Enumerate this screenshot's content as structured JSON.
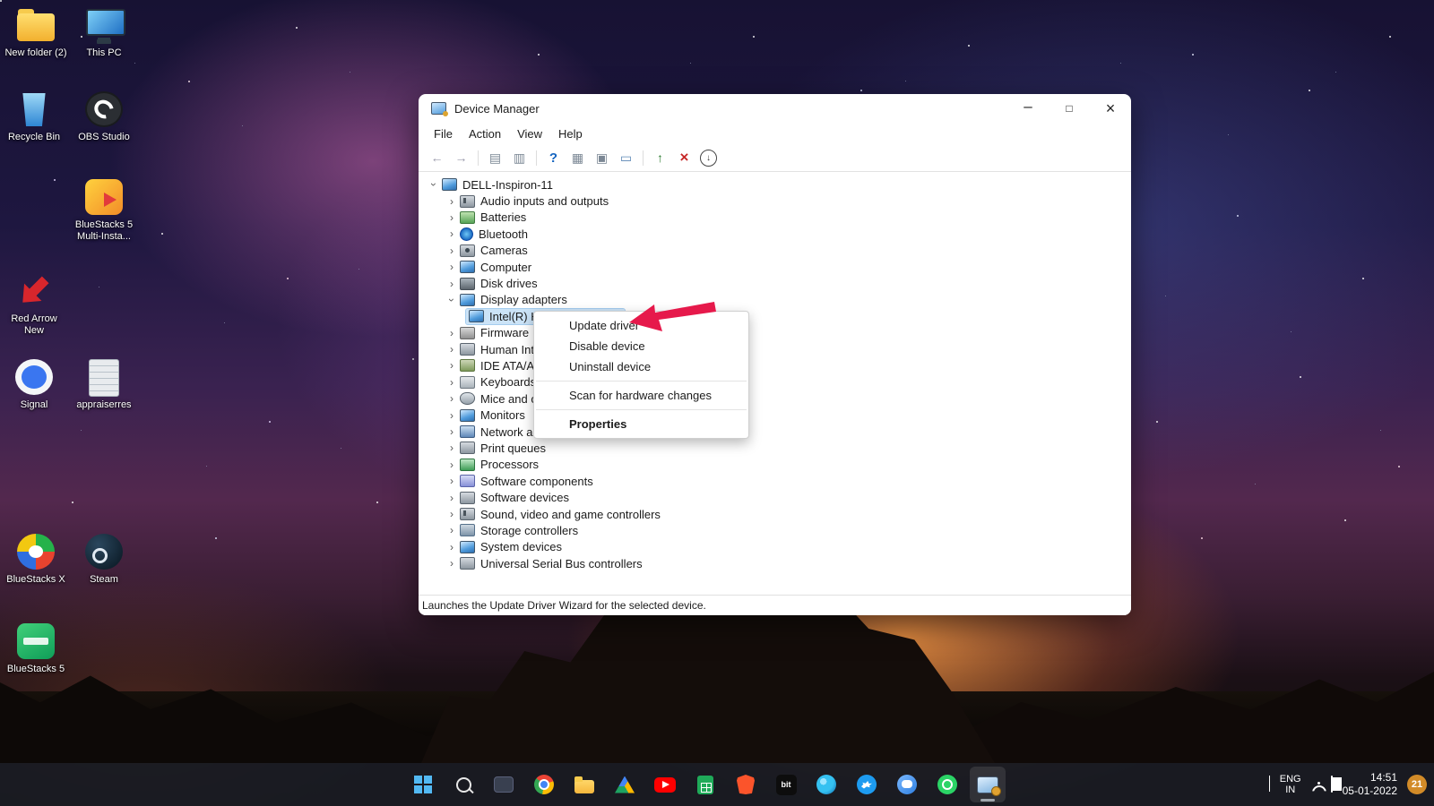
{
  "desktop": {
    "icons": [
      {
        "label": "New folder (2)",
        "icon": "folder"
      },
      {
        "label": "This PC",
        "icon": "this-pc"
      },
      {
        "label": "Recycle Bin",
        "icon": "recycle-bin"
      },
      {
        "label": "OBS Studio",
        "icon": "obs-studio"
      },
      {
        "label": "BlueStacks 5 Multi-Insta...",
        "icon": "bluestacks-multi"
      },
      {
        "label": "Red Arrow New",
        "icon": "red-arrow"
      },
      {
        "label": "Signal",
        "icon": "signal"
      },
      {
        "label": "appraiserres",
        "icon": "notepad"
      },
      {
        "label": "BlueStacks X",
        "icon": "bluestacks-x"
      },
      {
        "label": "Steam",
        "icon": "steam"
      },
      {
        "label": "BlueStacks 5",
        "icon": "bluestacks-5"
      }
    ]
  },
  "window": {
    "title": "Device Manager",
    "menu": [
      "File",
      "Action",
      "View",
      "Help"
    ],
    "toolbar_icons": [
      "back",
      "forward",
      "console-tree",
      "export-list",
      "help",
      "devices-by-type",
      "scan-hardware-changes",
      "monitor",
      "update-driver",
      "uninstall-device",
      "disable-device"
    ],
    "tree": {
      "root": "DELL-Inspiron-11",
      "items": [
        {
          "label": "Audio inputs and outputs",
          "icon": "speaker"
        },
        {
          "label": "Batteries",
          "icon": "battery"
        },
        {
          "label": "Bluetooth",
          "icon": "bluetooth"
        },
        {
          "label": "Cameras",
          "icon": "camera"
        },
        {
          "label": "Computer",
          "icon": "computer"
        },
        {
          "label": "Disk drives",
          "icon": "disk"
        },
        {
          "label": "Display adapters",
          "icon": "display",
          "expanded": true
        },
        {
          "label": "Intel(R) HD Graphics 620",
          "icon": "gpu",
          "child": true,
          "selected": true
        },
        {
          "label": "Firmware",
          "icon": "firmware"
        },
        {
          "label": "Human Interface Devices",
          "icon": "hid"
        },
        {
          "label": "IDE ATA/ATAPI controllers",
          "icon": "ide"
        },
        {
          "label": "Keyboards",
          "icon": "keyboard"
        },
        {
          "label": "Mice and other pointing devices",
          "icon": "mouse"
        },
        {
          "label": "Monitors",
          "icon": "monitor"
        },
        {
          "label": "Network adapters",
          "icon": "network"
        },
        {
          "label": "Print queues",
          "icon": "printer"
        },
        {
          "label": "Processors",
          "icon": "processor"
        },
        {
          "label": "Software components",
          "icon": "software-component"
        },
        {
          "label": "Software devices",
          "icon": "software-device"
        },
        {
          "label": "Sound, video and game controllers",
          "icon": "sound"
        },
        {
          "label": "Storage controllers",
          "icon": "storage"
        },
        {
          "label": "System devices",
          "icon": "system"
        },
        {
          "label": "Universal Serial Bus controllers",
          "icon": "usb"
        }
      ]
    },
    "status": "Launches the Update Driver Wizard for the selected device."
  },
  "context_menu": {
    "items": [
      "Update driver",
      "Disable device",
      "Uninstall device",
      "Scan for hardware changes",
      "Properties"
    ]
  },
  "taskbar": {
    "icons": [
      "start",
      "search",
      "task-view",
      "chrome",
      "file-explorer",
      "google-drive",
      "youtube",
      "sheets",
      "brave",
      "bit",
      "edge",
      "twitter",
      "chat",
      "whatsapp",
      "device-manager"
    ],
    "bit_label": "bit",
    "tray": {
      "language": "ENG",
      "region": "IN",
      "time": "14:51",
      "date": "05-01-2022",
      "badge": "21"
    }
  },
  "colors": {
    "accent": "#0078d4",
    "selection": "#cbe3f7",
    "annotation_arrow": "#e6194b"
  }
}
